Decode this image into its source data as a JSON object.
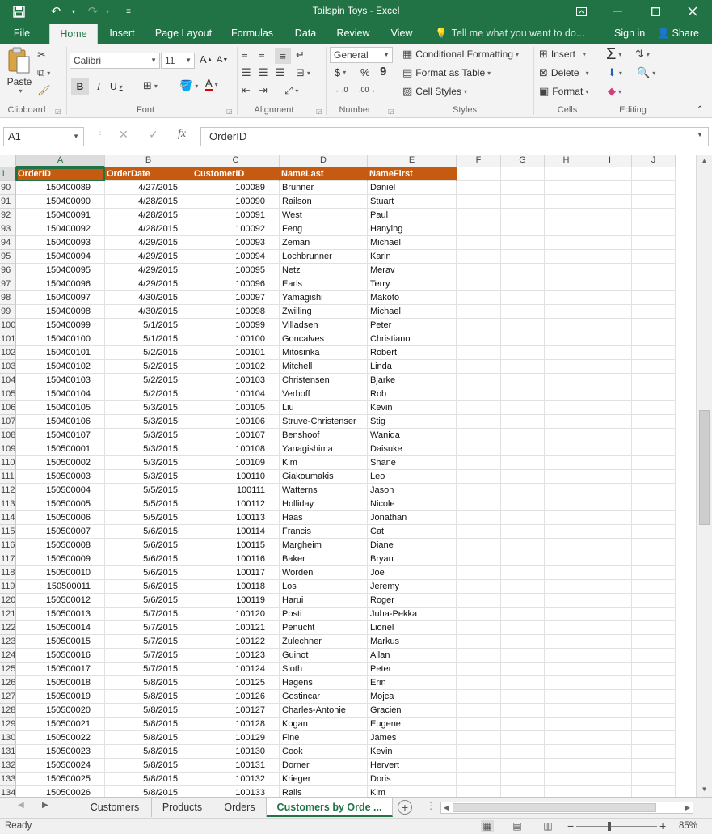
{
  "window": {
    "title": "Tailspin Toys - Excel",
    "controls": [
      "restore-ribbon",
      "minimize",
      "maximize",
      "close"
    ]
  },
  "ribbon_tabs": [
    "File",
    "Home",
    "Insert",
    "Page Layout",
    "Formulas",
    "Data",
    "Review",
    "View"
  ],
  "active_tab": "Home",
  "tell_me": "Tell me what you want to do...",
  "sign_in": "Sign in",
  "share": "Share",
  "ribbon": {
    "clipboard": {
      "label": "Clipboard",
      "paste": "Paste"
    },
    "font": {
      "label": "Font",
      "name": "Calibri",
      "size": "11",
      "bold": "B",
      "italic": "I",
      "underline": "U"
    },
    "alignment": {
      "label": "Alignment"
    },
    "number": {
      "label": "Number",
      "format": "General",
      "currency": "$",
      "percent": "%",
      "comma": "9"
    },
    "styles": {
      "label": "Styles",
      "conditional": "Conditional Formatting",
      "table": "Format as Table",
      "cell_styles": "Cell Styles"
    },
    "cells": {
      "label": "Cells",
      "insert": "Insert",
      "delete": "Delete",
      "format": "Format"
    },
    "editing": {
      "label": "Editing"
    }
  },
  "formula_bar": {
    "name_box": "A1",
    "cancel": "✕",
    "enter": "✓",
    "fx": "fx",
    "value": "OrderID"
  },
  "columns": [
    "A",
    "B",
    "C",
    "D",
    "E",
    "F",
    "G",
    "H",
    "I",
    "J"
  ],
  "header_row": {
    "row_number": "1",
    "cells": [
      "OrderID",
      "OrderDate",
      "CustomerID",
      "NameLast",
      "NameFirst"
    ]
  },
  "rows": [
    [
      "90",
      "150400089",
      "4/27/2015",
      "100089",
      "Brunner",
      "Daniel"
    ],
    [
      "91",
      "150400090",
      "4/28/2015",
      "100090",
      "Railson",
      "Stuart"
    ],
    [
      "92",
      "150400091",
      "4/28/2015",
      "100091",
      "West",
      "Paul"
    ],
    [
      "93",
      "150400092",
      "4/28/2015",
      "100092",
      "Feng",
      "Hanying"
    ],
    [
      "94",
      "150400093",
      "4/29/2015",
      "100093",
      "Zeman",
      "Michael"
    ],
    [
      "95",
      "150400094",
      "4/29/2015",
      "100094",
      "Lochbrunner",
      "Karin"
    ],
    [
      "96",
      "150400095",
      "4/29/2015",
      "100095",
      "Netz",
      "Merav"
    ],
    [
      "97",
      "150400096",
      "4/29/2015",
      "100096",
      "Earls",
      "Terry"
    ],
    [
      "98",
      "150400097",
      "4/30/2015",
      "100097",
      "Yamagishi",
      "Makoto"
    ],
    [
      "99",
      "150400098",
      "4/30/2015",
      "100098",
      "Zwilling",
      "Michael"
    ],
    [
      "100",
      "150400099",
      "5/1/2015",
      "100099",
      "Villadsen",
      "Peter"
    ],
    [
      "101",
      "150400100",
      "5/1/2015",
      "100100",
      "Goncalves",
      "Christiano"
    ],
    [
      "102",
      "150400101",
      "5/2/2015",
      "100101",
      "Mitosinka",
      "Robert"
    ],
    [
      "103",
      "150400102",
      "5/2/2015",
      "100102",
      "Mitchell",
      "Linda"
    ],
    [
      "104",
      "150400103",
      "5/2/2015",
      "100103",
      "Christensen",
      "Bjarke"
    ],
    [
      "105",
      "150400104",
      "5/2/2015",
      "100104",
      "Verhoff",
      "Rob"
    ],
    [
      "106",
      "150400105",
      "5/3/2015",
      "100105",
      "Liu",
      "Kevin"
    ],
    [
      "107",
      "150400106",
      "5/3/2015",
      "100106",
      "Struve-Christenser",
      "Stig"
    ],
    [
      "108",
      "150400107",
      "5/3/2015",
      "100107",
      "Benshoof",
      "Wanida"
    ],
    [
      "109",
      "150500001",
      "5/3/2015",
      "100108",
      "Yanagishima",
      "Daisuke"
    ],
    [
      "110",
      "150500002",
      "5/3/2015",
      "100109",
      "Kim",
      "Shane"
    ],
    [
      "111",
      "150500003",
      "5/3/2015",
      "100110",
      "Giakoumakis",
      "Leo"
    ],
    [
      "112",
      "150500004",
      "5/5/2015",
      "100111",
      "Watterns",
      "Jason"
    ],
    [
      "113",
      "150500005",
      "5/5/2015",
      "100112",
      "Holliday",
      "Nicole"
    ],
    [
      "114",
      "150500006",
      "5/5/2015",
      "100113",
      "Haas",
      "Jonathan"
    ],
    [
      "115",
      "150500007",
      "5/6/2015",
      "100114",
      "Francis",
      "Cat"
    ],
    [
      "116",
      "150500008",
      "5/6/2015",
      "100115",
      "Margheim",
      "Diane"
    ],
    [
      "117",
      "150500009",
      "5/6/2015",
      "100116",
      "Baker",
      "Bryan"
    ],
    [
      "118",
      "150500010",
      "5/6/2015",
      "100117",
      "Worden",
      "Joe"
    ],
    [
      "119",
      "150500011",
      "5/6/2015",
      "100118",
      "Los",
      "Jeremy"
    ],
    [
      "120",
      "150500012",
      "5/6/2015",
      "100119",
      "Harui",
      "Roger"
    ],
    [
      "121",
      "150500013",
      "5/7/2015",
      "100120",
      "Posti",
      "Juha-Pekka"
    ],
    [
      "122",
      "150500014",
      "5/7/2015",
      "100121",
      "Penucht",
      "Lionel"
    ],
    [
      "123",
      "150500015",
      "5/7/2015",
      "100122",
      "Zulechner",
      "Markus"
    ],
    [
      "124",
      "150500016",
      "5/7/2015",
      "100123",
      "Guinot",
      "Allan"
    ],
    [
      "125",
      "150500017",
      "5/7/2015",
      "100124",
      "Sloth",
      "Peter"
    ],
    [
      "126",
      "150500018",
      "5/8/2015",
      "100125",
      "Hagens",
      "Erin"
    ],
    [
      "127",
      "150500019",
      "5/8/2015",
      "100126",
      "Gostincar",
      "Mojca"
    ],
    [
      "128",
      "150500020",
      "5/8/2015",
      "100127",
      "Charles-Antonie",
      "Gracien"
    ],
    [
      "129",
      "150500021",
      "5/8/2015",
      "100128",
      "Kogan",
      "Eugene"
    ],
    [
      "130",
      "150500022",
      "5/8/2015",
      "100129",
      "Fine",
      "James"
    ],
    [
      "131",
      "150500023",
      "5/8/2015",
      "100130",
      "Cook",
      "Kevin"
    ],
    [
      "132",
      "150500024",
      "5/8/2015",
      "100131",
      "Dorner",
      "Hervert"
    ],
    [
      "133",
      "150500025",
      "5/8/2015",
      "100132",
      "Krieger",
      "Doris"
    ],
    [
      "134",
      "150500026",
      "5/8/2015",
      "100133",
      "Ralls",
      "Kim"
    ]
  ],
  "sheet_tabs": [
    "Customers",
    "Products",
    "Orders",
    "Customers by Orde ..."
  ],
  "active_sheet": "Customers by Orde ...",
  "status": {
    "ready": "Ready",
    "zoom": "85%"
  },
  "colors": {
    "excel_green": "#217346",
    "header_fill": "#c55a11",
    "header_text": "#ffffff"
  }
}
